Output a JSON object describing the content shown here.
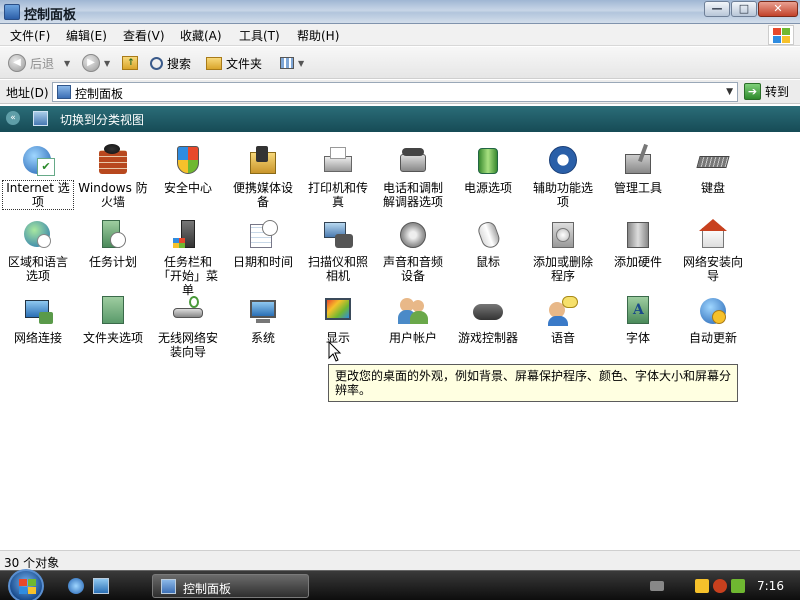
{
  "window": {
    "title": "控制面板",
    "min_glyph": "—",
    "max_glyph": "□",
    "close_glyph": "✕"
  },
  "menu": [
    "文件(F)",
    "编辑(E)",
    "查看(V)",
    "收藏(A)",
    "工具(T)",
    "帮助(H)"
  ],
  "toolbar": {
    "back": "后退",
    "search": "搜索",
    "folders": "文件夹",
    "back_glyph": "◀",
    "forward_glyph": "▶",
    "drop_glyph": "▼"
  },
  "address": {
    "label": "地址(D)",
    "value": "控制面板",
    "go": "转到",
    "go_glyph": "➔"
  },
  "switch_view": {
    "label": "切换到分类视图",
    "chevron_glyph": "«"
  },
  "items": [
    {
      "label": "Internet 选项",
      "icon": "internet-options-icon"
    },
    {
      "label": "Windows 防火墙",
      "icon": "firewall-icon"
    },
    {
      "label": "安全中心",
      "icon": "security-center-icon"
    },
    {
      "label": "便携媒体设备",
      "icon": "portable-media-icon"
    },
    {
      "label": "打印机和传真",
      "icon": "printer-icon"
    },
    {
      "label": "电话和调制解调器选项",
      "icon": "phone-modem-icon"
    },
    {
      "label": "电源选项",
      "icon": "power-options-icon"
    },
    {
      "label": "辅助功能选项",
      "icon": "accessibility-icon"
    },
    {
      "label": "管理工具",
      "icon": "admin-tools-icon"
    },
    {
      "label": "键盘",
      "icon": "keyboard-icon"
    },
    {
      "label": "区域和语言选项",
      "icon": "region-language-icon"
    },
    {
      "label": "任务计划",
      "icon": "scheduled-tasks-icon"
    },
    {
      "label": "任务栏和「开始」菜单",
      "icon": "taskbar-start-icon"
    },
    {
      "label": "日期和时间",
      "icon": "date-time-icon"
    },
    {
      "label": "扫描仪和照相机",
      "icon": "scanner-camera-icon"
    },
    {
      "label": "声音和音频设备",
      "icon": "sound-icon"
    },
    {
      "label": "鼠标",
      "icon": "mouse-icon"
    },
    {
      "label": "添加或删除程序",
      "icon": "add-remove-programs-icon"
    },
    {
      "label": "添加硬件",
      "icon": "add-hardware-icon"
    },
    {
      "label": "网络安装向导",
      "icon": "network-setup-icon"
    },
    {
      "label": "网络连接",
      "icon": "network-connections-icon"
    },
    {
      "label": "文件夹选项",
      "icon": "folder-options-icon"
    },
    {
      "label": "无线网络安装向导",
      "icon": "wireless-setup-icon"
    },
    {
      "label": "系统",
      "icon": "system-icon"
    },
    {
      "label": "显示",
      "icon": "display-icon"
    },
    {
      "label": "用户帐户",
      "icon": "user-accounts-icon"
    },
    {
      "label": "游戏控制器",
      "icon": "game-controllers-icon"
    },
    {
      "label": "语音",
      "icon": "speech-icon"
    },
    {
      "label": "字体",
      "icon": "fonts-icon"
    },
    {
      "label": "自动更新",
      "icon": "automatic-updates-icon"
    }
  ],
  "tooltip": "更改您的桌面的外观，例如背景、屏幕保护程序、颜色、字体大小和屏幕分辨率。",
  "status": "30 个对象",
  "taskbar": {
    "task_label": "控制面板",
    "clock": "7:16"
  }
}
